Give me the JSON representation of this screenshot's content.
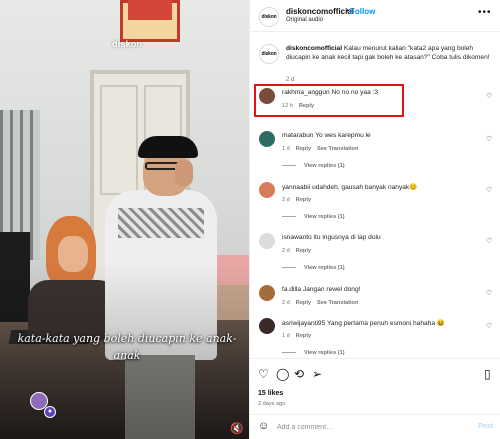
{
  "video": {
    "watermark": "diskon",
    "caption": "kata-kata yang boleh diucapin ke anak-anak",
    "mute_icon": "muted-speaker-icon"
  },
  "header": {
    "username": "diskoncomofficial",
    "separator": "•",
    "follow_label": "Follow",
    "audio": "Original audio",
    "avatar_text": "diskon",
    "more_icon": "more-horizontal-icon"
  },
  "post": {
    "username": "diskoncomofficial",
    "caption": "Kalau menurut kalian \"kata2 apa yang boleh diucapin ke anak kecil tapi gak boleh ke atasan?\" Coba tulis dikomen!",
    "time": "2 d"
  },
  "comments": [
    {
      "user": "rakhma_anggun",
      "text": "No no no yaa :3",
      "time": "12 h",
      "reply": "Reply",
      "translation": "",
      "view_replies": "",
      "avatar_color": "#7a4a3a"
    },
    {
      "user": "matarabun",
      "text": "Yo wes karepmu le",
      "time": "1 d",
      "reply": "Reply",
      "translation": "See Translation",
      "view_replies": "View replies (1)",
      "avatar_color": "#2f6b63"
    },
    {
      "user": "yannaabii",
      "text": "udahdeh, gausah banyak nanyak😊",
      "time": "2 d",
      "reply": "Reply",
      "translation": "",
      "view_replies": "View replies (1)",
      "avatar_color": "#d97b5a"
    },
    {
      "user": "isnawanto",
      "text": "itu ingusnya di lap dulu",
      "time": "2 d",
      "reply": "Reply",
      "translation": "",
      "view_replies": "View replies (1)",
      "avatar_color": "#dcdcdc"
    },
    {
      "user": "fa.dilla",
      "text": "Jangan rewel dong!",
      "time": "2 d",
      "reply": "Reply",
      "translation": "See Translation",
      "view_replies": "",
      "avatar_color": "#a46b3b"
    },
    {
      "user": "asriwijayanti95",
      "text": "Yang pertama penuh esmoni hahaha 😆",
      "time": "1 d",
      "reply": "Reply",
      "translation": "",
      "view_replies": "View replies (1)",
      "avatar_color": "#3a2a28"
    }
  ],
  "actions": {
    "like_icon": "heart-icon",
    "comment_icon": "comment-icon",
    "share_icon": "share-icon",
    "save_icon": "bookmark-icon",
    "likes": "15 likes",
    "date": "2 days ago"
  },
  "composer": {
    "emoji_icon": "smiley-icon",
    "placeholder": "Add a comment…",
    "post_label": "Post"
  },
  "colors": {
    "follow": "#0095f6",
    "highlight": "#e01414",
    "post_disabled": "#b2dffc"
  }
}
